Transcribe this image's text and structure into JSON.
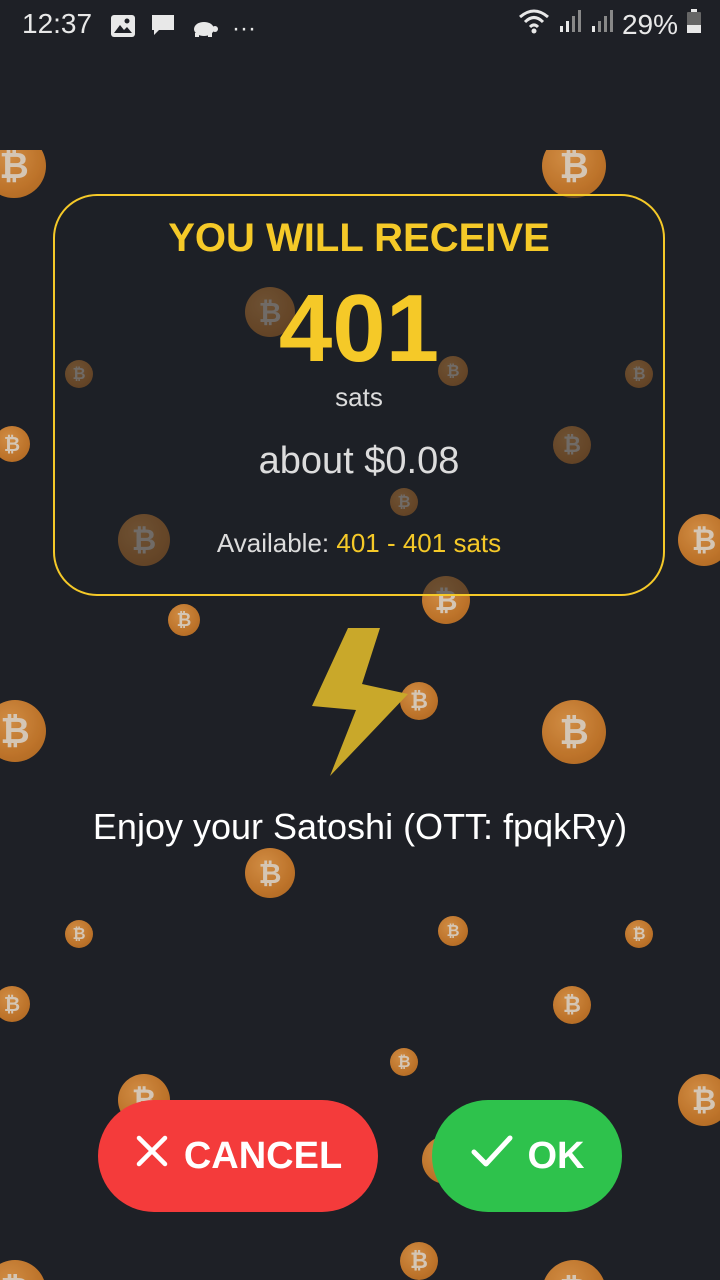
{
  "status_bar": {
    "time": "12:37",
    "more": "···",
    "battery": "29%",
    "icons": [
      "image-icon",
      "message-icon",
      "turtle-icon",
      "wifi-icon",
      "signal-icon",
      "signal-icon",
      "battery-icon"
    ]
  },
  "card": {
    "title": "YOU WILL RECEIVE",
    "amount": "401",
    "unit": "sats",
    "fiat": "about $0.08",
    "available_label": "Available:",
    "available_range": "401 - 401 sats"
  },
  "bolt_icon": "lightning-bolt-icon",
  "message": "Enjoy your Satoshi (OTT: fpqkRy)",
  "buttons": {
    "cancel": "CANCEL",
    "ok": "OK"
  },
  "colors": {
    "background": "#1e2026",
    "accent_yellow": "#f5c928",
    "cancel_red": "#f43b3b",
    "ok_green": "#2ec24c",
    "coin_orange": "#d9822b"
  },
  "coin_symbol": "₿"
}
